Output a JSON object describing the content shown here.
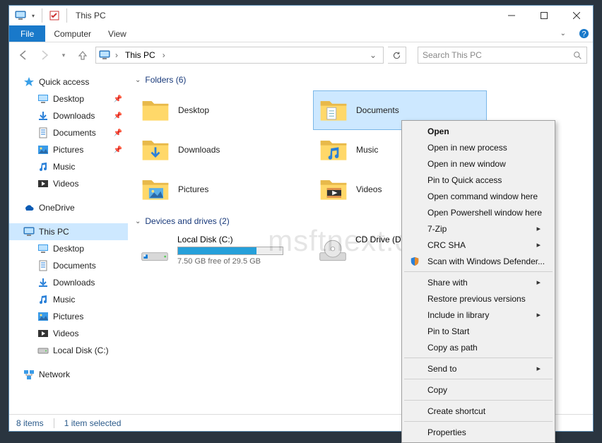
{
  "title": "This PC",
  "ribbon": {
    "file": "File",
    "computer": "Computer",
    "view": "View"
  },
  "breadcrumb": {
    "root": "This PC"
  },
  "search": {
    "placeholder": "Search This PC"
  },
  "sidebar": {
    "quick": "Quick access",
    "q_items": [
      {
        "label": "Desktop",
        "pin": true
      },
      {
        "label": "Downloads",
        "pin": true
      },
      {
        "label": "Documents",
        "pin": true
      },
      {
        "label": "Pictures",
        "pin": true
      },
      {
        "label": "Music",
        "pin": false
      },
      {
        "label": "Videos",
        "pin": false
      }
    ],
    "onedrive": "OneDrive",
    "thispc": "This PC",
    "tp_items": [
      "Desktop",
      "Documents",
      "Downloads",
      "Music",
      "Pictures",
      "Videos",
      "Local Disk (C:)"
    ],
    "network": "Network"
  },
  "folders_hdr": "Folders (6)",
  "folders": [
    "Desktop",
    "Documents",
    "Downloads",
    "Music",
    "Pictures",
    "Videos"
  ],
  "drives_hdr": "Devices and drives (2)",
  "drives": [
    {
      "label": "Local Disk (C:)",
      "sub": "7.50 GB free of 29.5 GB",
      "fill": 75
    },
    {
      "label": "CD Drive (D:)",
      "sub": ""
    }
  ],
  "status": {
    "count": "8 items",
    "sel": "1 item selected"
  },
  "watermark": "msftnext.com",
  "ctx": {
    "open": "Open",
    "npr": "Open in new process",
    "nw": "Open in new window",
    "pinq": "Pin to Quick access",
    "cmd": "Open command window here",
    "ps": "Open Powershell window here",
    "sz": "7-Zip",
    "crc": "CRC SHA",
    "def": "Scan with Windows Defender...",
    "share": "Share with",
    "restore": "Restore previous versions",
    "lib": "Include in library",
    "pins": "Pin to Start",
    "copyp": "Copy as path",
    "send": "Send to",
    "copy": "Copy",
    "cs": "Create shortcut",
    "prop": "Properties"
  }
}
